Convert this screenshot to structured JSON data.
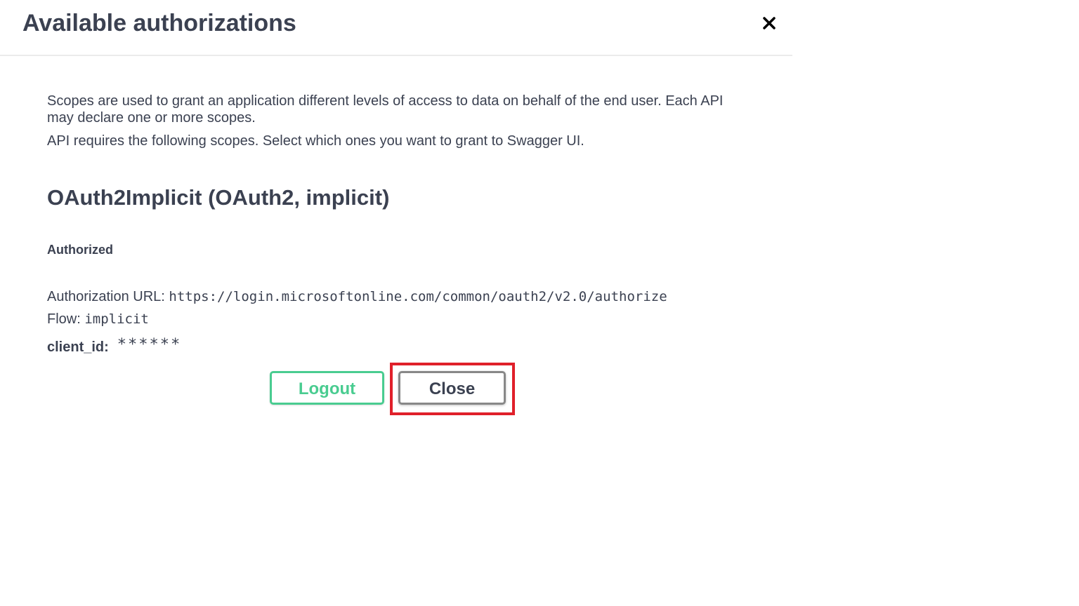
{
  "modal": {
    "title": "Available authorizations",
    "close_icon": "close-x-icon"
  },
  "description": {
    "scopes_text": "Scopes are used to grant an application different levels of access to data on behalf of the end user. Each API may declare one or more scopes.",
    "requires_text": "API requires the following scopes. Select which ones you want to grant to Swagger UI."
  },
  "scheme": {
    "title": "OAuth2Implicit (OAuth2, implicit)",
    "status": "Authorized",
    "auth_url_label": "Authorization URL: ",
    "auth_url_value": "https://login.microsoftonline.com/common/oauth2/v2.0/authorize",
    "flow_label": "Flow: ",
    "flow_value": "implicit",
    "client_id_label": "client_id:",
    "client_id_value": "******"
  },
  "buttons": {
    "logout_label": "Logout",
    "close_label": "Close"
  },
  "colors": {
    "text": "#3b4151",
    "logout_green": "#49cc90",
    "close_border": "#888888",
    "highlight_red": "#e0202a",
    "divider": "#ebebeb"
  }
}
